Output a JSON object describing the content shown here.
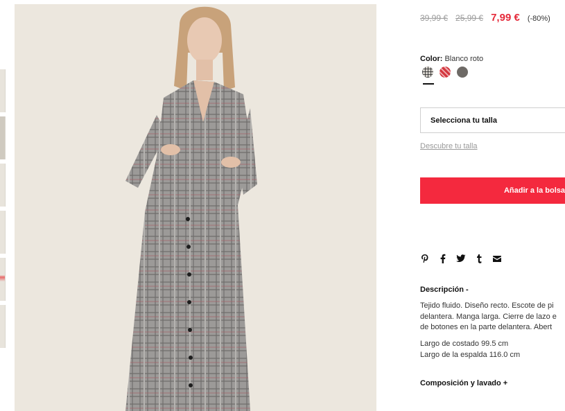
{
  "price": {
    "original_1": "39,99 €",
    "original_2": "25,99 €",
    "current": "7,99 €",
    "discount": "(-80%)"
  },
  "color": {
    "label": "Color:",
    "value": "Blanco roto",
    "swatches": [
      "plaid-swatch",
      "red-print-swatch",
      "grey-swatch"
    ]
  },
  "size": {
    "select_label": "Selecciona tu talla",
    "guide_link": "Descubre tu talla"
  },
  "cart": {
    "add_label": "Añadir a la bolsa"
  },
  "share_icons": [
    "pinterest-icon",
    "facebook-icon",
    "twitter-icon",
    "tumblr-icon",
    "mail-icon"
  ],
  "description": {
    "title": "Descripción -",
    "lines": [
      "Tejido fluido. Diseño recto. Escote de pi",
      "delantera. Manga larga. Cierre de lazo e",
      "de botones en la parte delantera. Abert"
    ],
    "measures": [
      "Largo de costado 99.5 cm",
      "Largo de la espalda 116.0 cm"
    ]
  },
  "composition": {
    "title": "Composición y lavado +"
  },
  "colors": {
    "accent": "#f4293e",
    "sale_price": "#e52a3a"
  }
}
